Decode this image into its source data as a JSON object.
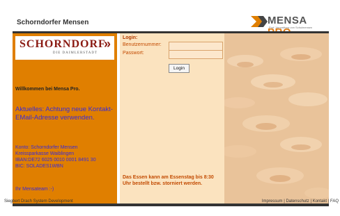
{
  "header": {
    "site_title": "Schorndorfer Mensen",
    "brand_mensa": "MENSA",
    "brand_pro": "PRO",
    "brand_sub": "Prof. Verwaltung von Schulmensen"
  },
  "logo": {
    "main": "SCHORNDORF",
    "chevron": "»",
    "sub": "DIE DAIMLERSTADT"
  },
  "left": {
    "welcome": "Willkommen bei Mensa Pro.",
    "news": "Aktuelles: Achtung neue Kontakt-EMail-Adresse verwenden.",
    "bank_lines": [
      "Konto: Schorndorfer Mensen",
      "Kreissparkasse Waiblingen",
      "IBAN:DE72 6025 0010 0001 8491 30",
      "BIC: SOLADES1WBN"
    ],
    "team": "Ihr Mensateam :-)"
  },
  "login": {
    "title": "Login:",
    "username_label": "Benutzernummer:",
    "username_value": "",
    "password_label": "Passwort:",
    "password_value": "",
    "button": "Login",
    "notice": "Das Essen kann am Essenstag bis 8:30 Uhr bestellt bzw. storniert werden."
  },
  "footer": {
    "left": "Siegbert Drach System Development",
    "links": [
      "Impressum",
      "Datenschutz",
      "Kontakt",
      "FAQ"
    ]
  },
  "colors": {
    "accent": "#e07f00",
    "panel": "#fbe3bf",
    "link_blue": "#3a2bd8",
    "login_text": "#c24a00"
  }
}
